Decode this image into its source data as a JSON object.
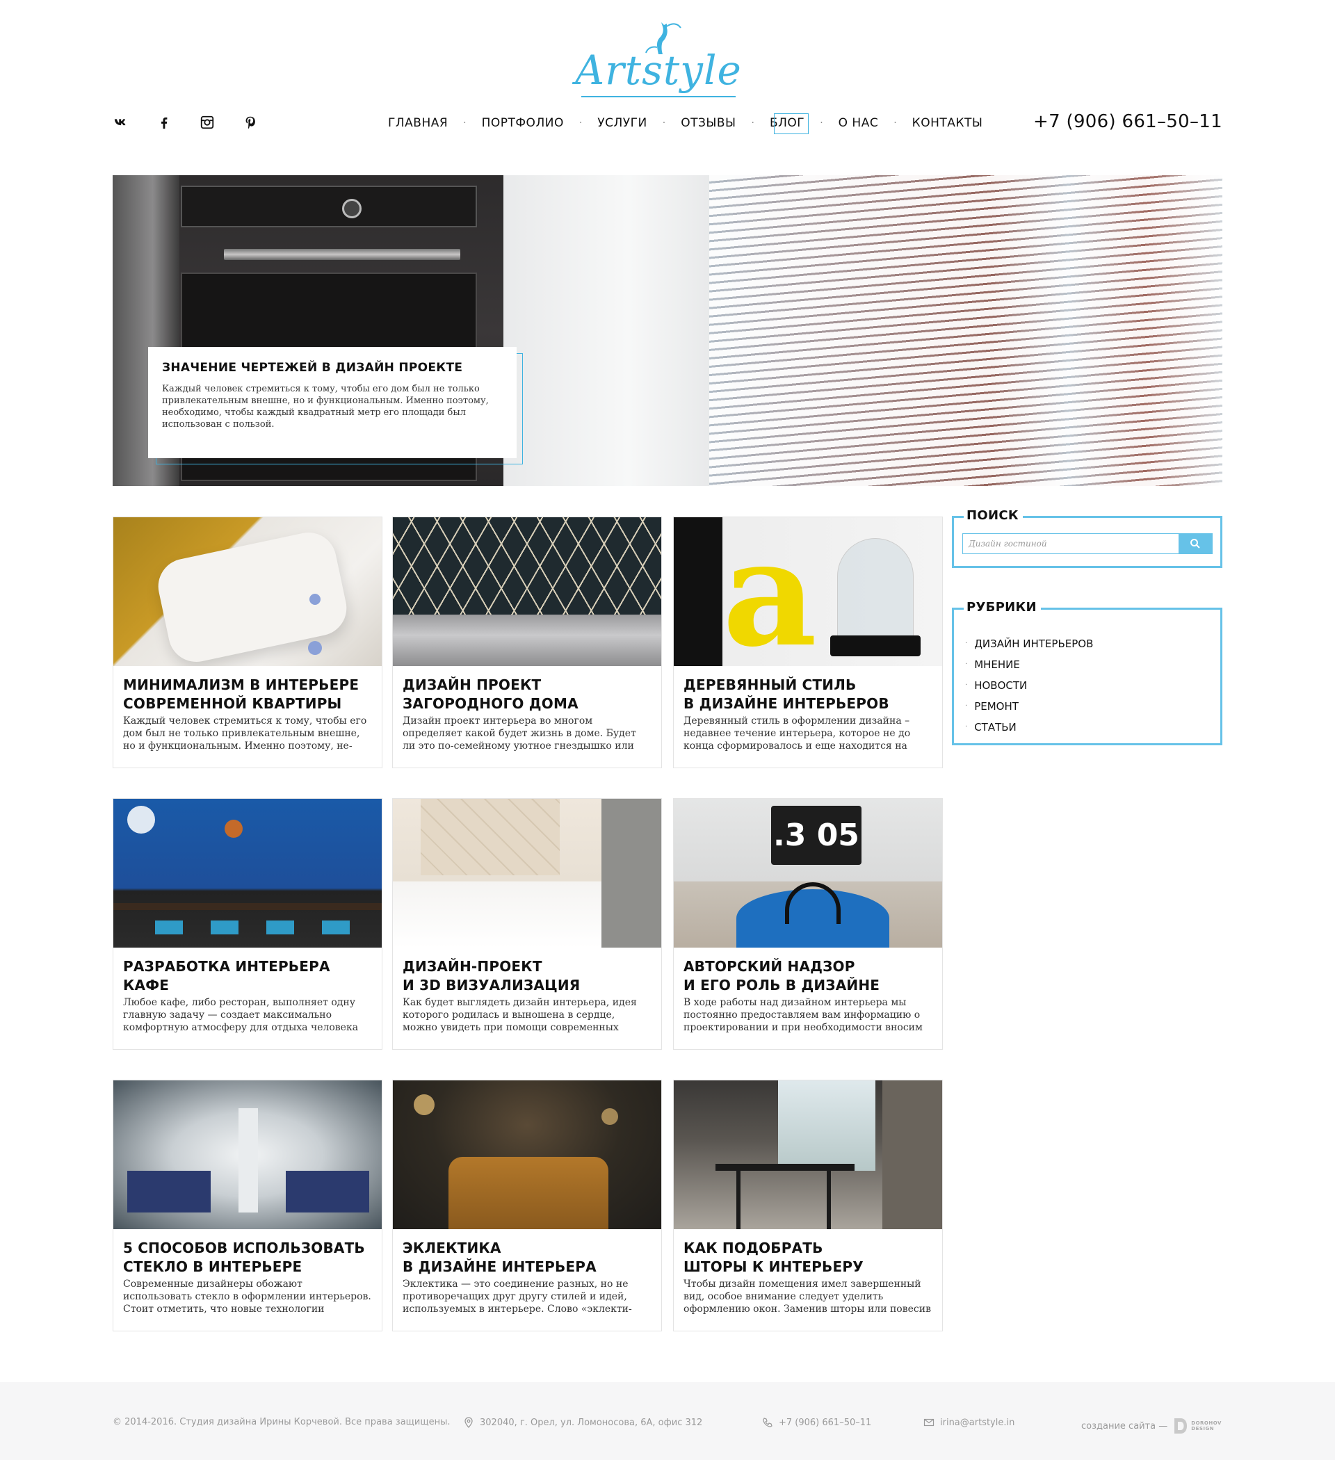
{
  "brand": {
    "logo_text": "Artstyle",
    "accent_color": "#3fb3e0"
  },
  "socials": [
    {
      "name": "vk",
      "icon": "vk-icon"
    },
    {
      "name": "facebook",
      "icon": "facebook-icon"
    },
    {
      "name": "instagram",
      "icon": "instagram-icon"
    },
    {
      "name": "pinterest",
      "icon": "pinterest-icon"
    }
  ],
  "nav": {
    "items": [
      {
        "label": "ГЛАВНАЯ"
      },
      {
        "label": "ПОРТФОЛИО"
      },
      {
        "label": "УСЛУГИ"
      },
      {
        "label": "ОТЗЫВЫ"
      },
      {
        "label": "БЛОГ",
        "active": true
      },
      {
        "label": "О НАС"
      },
      {
        "label": "КОНТАКТЫ"
      }
    ]
  },
  "header": {
    "phone": "+7 (906) 661–50–11"
  },
  "hero": {
    "title": "ЗНАЧЕНИЕ ЧЕРТЕЖЕЙ В ДИЗАЙН ПРОЕКТЕ",
    "text": "Каждый человек стремиться к тому, чтобы его дом был не только привлекательным внешне, но и функциональным. Именно поэтому, необходимо, чтобы каждый квадратный метр его площади был использован с пользой."
  },
  "posts": [
    {
      "title": "МИНИМАЛИЗМ В ИНТЕРЬЕРЕ\nСОВРЕМЕННОЙ КВАРТИРЫ",
      "text": "Каждый человек стремиться к тому, чтобы его дом был не только привлекательным внешне, но и функциональным. Именно поэтому, не-"
    },
    {
      "title": "ДИЗАЙН ПРОЕКТ\nЗАГОРОДНОГО ДОМА",
      "text": "Дизайн проект интерьера во многом определяет какой будет жизнь в доме. Будет ли это по-семейному уютное гнездышко или стиль-"
    },
    {
      "title": "ДЕРЕВЯННЫЙ СТИЛЬ\nВ ДИЗАЙНЕ ИНТЕРЬЕРОВ",
      "text": "Деревянный стиль в оформлении дизайна – недавнее течение интерьера, которое не до конца сформировалось и еще находится на"
    },
    {
      "title": "РАЗРАБОТКА ИНТЕРЬЕРА\nКАФЕ",
      "text": "Любое кафе, либо ресторан, выполняет одну главную задачу — создает максимально комфортную атмосферу для отдыха человека от"
    },
    {
      "title": "ДИЗАЙН-ПРОЕКТ\nИ 3D ВИЗУАЛИЗАЦИЯ",
      "text": "Как будет выглядеть дизайн интерьера, идея которого родилась и выношена в сердце, можно увидеть при помощи современных"
    },
    {
      "title": "АВТОРСКИЙ НАДЗОР\nИ ЕГО РОЛЬ В ДИЗАЙНЕ",
      "text": "В ходе работы над дизайном интерьера мы постоянно предоставляем вам информацию о проектировании и при необходимости вносим"
    },
    {
      "title": "5 СПОСОБОВ ИСПОЛЬЗОВАТЬ\nСТЕКЛО В ИНТЕРЬЕРЕ",
      "text": "Современные дизайнеры обожают использовать стекло в оформлении интерьеров. Стоит отметить, что новые технологии позволяют"
    },
    {
      "title": "ЭКЛЕКТИКА\nВ ДИЗАЙНЕ ИНТЕРЬЕРА",
      "text": "Эклектика — это соединение разных, но не противоречащих друг другу стилей и идей, используемых в интерьере. Слово «эклекти-"
    },
    {
      "title": "КАК ПОДОБРАТЬ\nШТОРЫ К ИНТЕРЬЕРУ",
      "text": "Чтобы дизайн помещения имел завершенный вид, особое внимание следует уделить оформлению окон. Заменив шторы или повесив их"
    }
  ],
  "sidebar": {
    "search": {
      "title": "ПОИСК",
      "placeholder": "Дизайн гостиной"
    },
    "rubrics": {
      "title": "РУБРИКИ",
      "items": [
        "ДИЗАЙН ИНТЕРЬЕРОВ",
        "МНЕНИЕ",
        "НОВОСТИ",
        "РЕМОНТ",
        "СТАТЬИ"
      ]
    }
  },
  "footer": {
    "copyright": "© 2014-2016. Студия дизайна Ирины Корчевой. Все права защищены.",
    "address": "302040, г. Орел, ул. Ломоносова, 6А, офис 312",
    "phone": "+7 (906) 661–50–11",
    "email": "irina@artstyle.in",
    "credit": "создание сайта —",
    "credit_logo_line1": "DOROHOV",
    "credit_logo_line2": "DESIGN"
  }
}
